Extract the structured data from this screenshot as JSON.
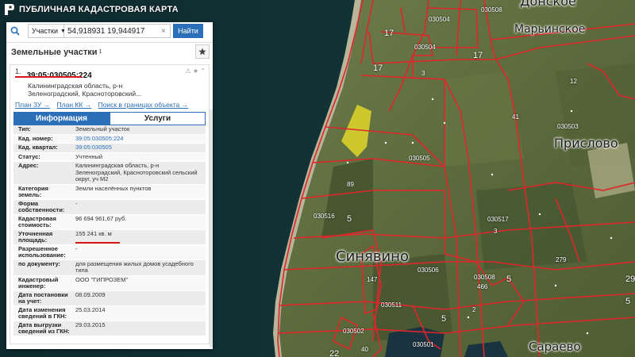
{
  "app": {
    "title": "ПУБЛИЧНАЯ КАДАСТРОВАЯ КАРТА"
  },
  "search": {
    "type_label": "Участки",
    "query": "54,918931 19,944917",
    "button_label": "Найти"
  },
  "section": {
    "title": "Земельные участки",
    "count": "1"
  },
  "result": {
    "index": "1.",
    "cadastral_number": "39:05:030505:224",
    "address_short_1": "Калининградская область, р-н",
    "address_short_2": "Зеленоградский, Красноторовский...",
    "links": [
      "План ЗУ →",
      "План КК →",
      "Поиск в границах объекта →"
    ]
  },
  "tabs": {
    "info": "Информация",
    "services": "Услуги"
  },
  "properties": [
    {
      "key": "Тип:",
      "value": "Земельный участок"
    },
    {
      "key": "Кад. номер:",
      "value": "39:05:030505:224",
      "link": true
    },
    {
      "key": "Кад. квартал:",
      "value": "39:05:030505",
      "link": true
    },
    {
      "key": "Статус:",
      "value": "Учтенный"
    },
    {
      "key": "Адрес:",
      "value": "Калининградская область, р-н Зеленоградский, Красноторовский сельский округ, уч М2"
    },
    {
      "key": "Категория земель:",
      "value": "Земли населённых пунктов"
    },
    {
      "key": "Форма собственности:",
      "value": "-"
    },
    {
      "key": "Кадастровая стоимость:",
      "value": "96 694 961,67 руб."
    },
    {
      "key": "Уточненная площадь:",
      "value": "155 241 кв. м"
    },
    {
      "key": "Разрешенное использование:",
      "value": "-"
    },
    {
      "key": "по документу:",
      "value": "для размещения жилых домов усадебного типа"
    },
    {
      "key": "Кадастровый инженер:",
      "value": "ООО \"ГИПРОЗЕМ\""
    },
    {
      "key": "Дата постановки на учет:",
      "value": "08.09.2009"
    },
    {
      "key": "Дата изменения сведений в ГКН:",
      "value": "25.03.2014"
    },
    {
      "key": "Дата выгрузки сведений из ГКН:",
      "value": "29.03.2015"
    }
  ],
  "map": {
    "places": [
      "Марьинское",
      "Прислово",
      "Синявино",
      "Сараево",
      "Донское"
    ],
    "parcel_numbers": [
      "17",
      "17",
      "17",
      "3",
      "12",
      "41",
      "5",
      "147",
      "89",
      "5",
      "279",
      "3",
      "5",
      "466",
      "40",
      "22",
      "2",
      "5",
      "29"
    ],
    "quarter_codes": [
      "030504",
      "030503",
      "030505",
      "030516",
      "030517",
      "030508",
      "030506",
      "030502",
      "030501",
      "030504",
      "030508",
      "030511"
    ]
  },
  "colors": {
    "accent": "#2a6fb8",
    "parcel_line": "#e0262b",
    "highlight": "#e1d62a"
  }
}
